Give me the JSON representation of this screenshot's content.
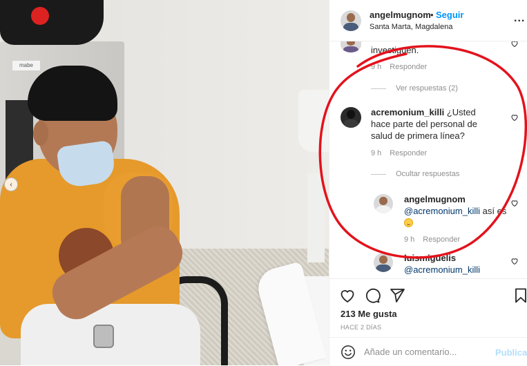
{
  "header": {
    "username": "angelmugnom",
    "separator": "•",
    "follow_label": "Seguir",
    "location": "Santa Marta, Magdalena",
    "more_label": "..."
  },
  "photo": {
    "brand_label": "mabe",
    "prev_label": "‹"
  },
  "comments": {
    "prev_comment": {
      "text_tail": "investiguen.",
      "time": "9 h",
      "reply_label": "Responder",
      "view_replies_label": "Ver respuestas (2)"
    },
    "main": {
      "username": "acremonium_killi",
      "text": "¿Usted hace parte del personal de salud de primera línea?",
      "time": "9 h",
      "reply_label": "Responder",
      "hide_replies_label": "Ocultar respuestas"
    },
    "replies": [
      {
        "username": "angelmugnom",
        "mention": "@acremonium_killi",
        "text": "así es",
        "time": "9 h",
        "reply_label": "Responder"
      },
      {
        "username": "luismiguelis",
        "mention": "@acremonium_killi"
      }
    ]
  },
  "actions": {
    "likes": "213 Me gusta",
    "time_ago": "HACE 2 DÍAS"
  },
  "add_comment": {
    "placeholder": "Añade un comentario...",
    "post_label": "Publicar"
  },
  "colors": {
    "accent": "#0095f6",
    "post_disabled": "#b2dffc",
    "annotation": "#e3121c",
    "secondary_text": "#8e8e8e"
  }
}
